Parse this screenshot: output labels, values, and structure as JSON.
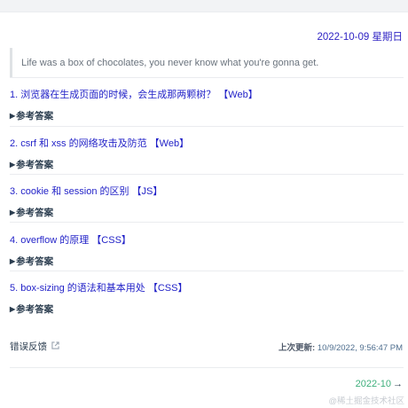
{
  "header": {
    "date": "2022-10-09 星期日"
  },
  "quote": "Life was a box of chocolates, you never know what you're gonna get.",
  "questions": [
    {
      "title": "1. 浏览器在生成页面的时候，会生成那两颗树？ 【Web】",
      "answer_label": "参考答案"
    },
    {
      "title": "2. csrf 和 xss 的网络攻击及防范 【Web】",
      "answer_label": "参考答案"
    },
    {
      "title": "3. cookie 和 session 的区别 【JS】",
      "answer_label": "参考答案"
    },
    {
      "title": "4. overflow 的原理 【CSS】",
      "answer_label": "参考答案"
    },
    {
      "title": "5. box-sizing 的语法和基本用处 【CSS】",
      "answer_label": "参考答案"
    }
  ],
  "footer": {
    "edit_link": "错误反馈",
    "last_updated_label": "上次更新:",
    "last_updated_value": " 10/9/2022, 9:56:47 PM"
  },
  "nav": {
    "next_label": "2022-10",
    "next_arrow": "→"
  },
  "watermark": "@稀土掘金技术社区",
  "colors": {
    "link": "#1f1fc7",
    "accent": "#3eaf7c",
    "date": "#2f23c4"
  }
}
